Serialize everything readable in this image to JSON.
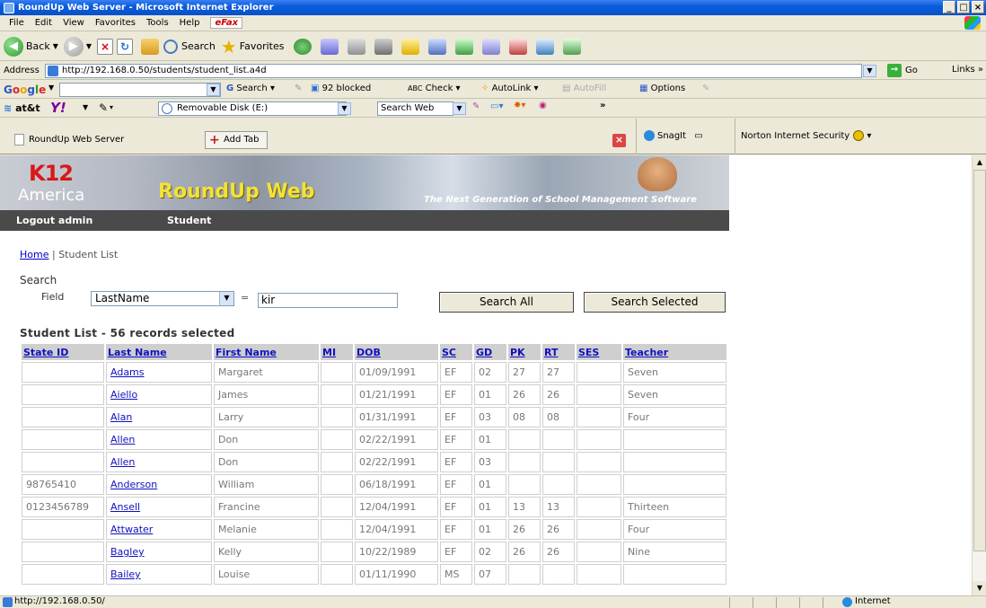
{
  "window": {
    "title": "RoundUp Web Server - Microsoft Internet Explorer"
  },
  "menu": [
    "File",
    "Edit",
    "View",
    "Favorites",
    "Tools",
    "Help"
  ],
  "menu_efax": "eFax",
  "toolbar": {
    "back": "Back",
    "search": "Search",
    "favorites": "Favorites"
  },
  "address": {
    "label": "Address",
    "url": "http://192.168.0.50/students/student_list.a4d",
    "go": "Go",
    "links": "Links"
  },
  "googlebar": {
    "logo": [
      "G",
      "o",
      "o",
      "g",
      "l",
      "e"
    ],
    "search": "Search",
    "blocked": "92 blocked",
    "check": "Check",
    "autolink": "AutoLink",
    "autofill": "AutoFill",
    "options": "Options"
  },
  "attbar": {
    "logo": "at&t",
    "yahoo": "Y!",
    "removable": "Removable Disk (E:)",
    "search_web": "Search Web"
  },
  "tabs": {
    "current": "RoundUp Web Server",
    "add": "Add Tab",
    "snagit": "SnagIt",
    "norton": "Norton Internet Security"
  },
  "banner": {
    "k12": "K12",
    "america": "America",
    "product": "RoundUp Web",
    "tagline": "The Next Generation of School Management Software"
  },
  "nav": {
    "logout": "Logout admin",
    "student": "Student"
  },
  "breadcrumb": {
    "home": "Home",
    "separator": " | ",
    "current": "Student List"
  },
  "search": {
    "label": "Search",
    "field_label": "Field",
    "field_value": "LastName",
    "equals": "=",
    "value": "kir",
    "search_all": "Search All",
    "search_selected": "Search Selected"
  },
  "list": {
    "title": "Student List - 56 records selected",
    "headers": [
      "State ID",
      "Last Name",
      "First Name",
      "MI",
      "DOB",
      "SC",
      "GD",
      "PK",
      "RT",
      "SES",
      "Teacher"
    ],
    "rows": [
      [
        "",
        "Adams",
        "Margaret",
        "",
        "01/09/1991",
        "EF",
        "02",
        "27",
        "27",
        "",
        "Seven"
      ],
      [
        "",
        "Aiello",
        "James",
        "",
        "01/21/1991",
        "EF",
        "01",
        "26",
        "26",
        "",
        "Seven"
      ],
      [
        "",
        "Alan",
        "Larry",
        "",
        "01/31/1991",
        "EF",
        "03",
        "08",
        "08",
        "",
        "Four"
      ],
      [
        "",
        "Allen",
        "Don",
        "",
        "02/22/1991",
        "EF",
        "01",
        "",
        "",
        "",
        ""
      ],
      [
        "",
        "Allen",
        "Don",
        "",
        "02/22/1991",
        "EF",
        "03",
        "",
        "",
        "",
        ""
      ],
      [
        "98765410",
        "Anderson",
        "William",
        "",
        "06/18/1991",
        "EF",
        "01",
        "",
        "",
        "",
        ""
      ],
      [
        "0123456789",
        "Ansell",
        "Francine",
        "",
        "12/04/1991",
        "EF",
        "01",
        "13",
        "13",
        "",
        "Thirteen"
      ],
      [
        "",
        "Attwater",
        "Melanie",
        "",
        "12/04/1991",
        "EF",
        "01",
        "26",
        "26",
        "",
        "Four"
      ],
      [
        "",
        "Bagley",
        "Kelly",
        "",
        "10/22/1989",
        "EF",
        "02",
        "26",
        "26",
        "",
        "Nine"
      ],
      [
        "",
        "Bailey",
        "Louise",
        "",
        "01/11/1990",
        "MS",
        "07",
        "",
        "",
        "",
        ""
      ]
    ]
  },
  "status": {
    "url": "http://192.168.0.50/",
    "zone": "Internet"
  }
}
